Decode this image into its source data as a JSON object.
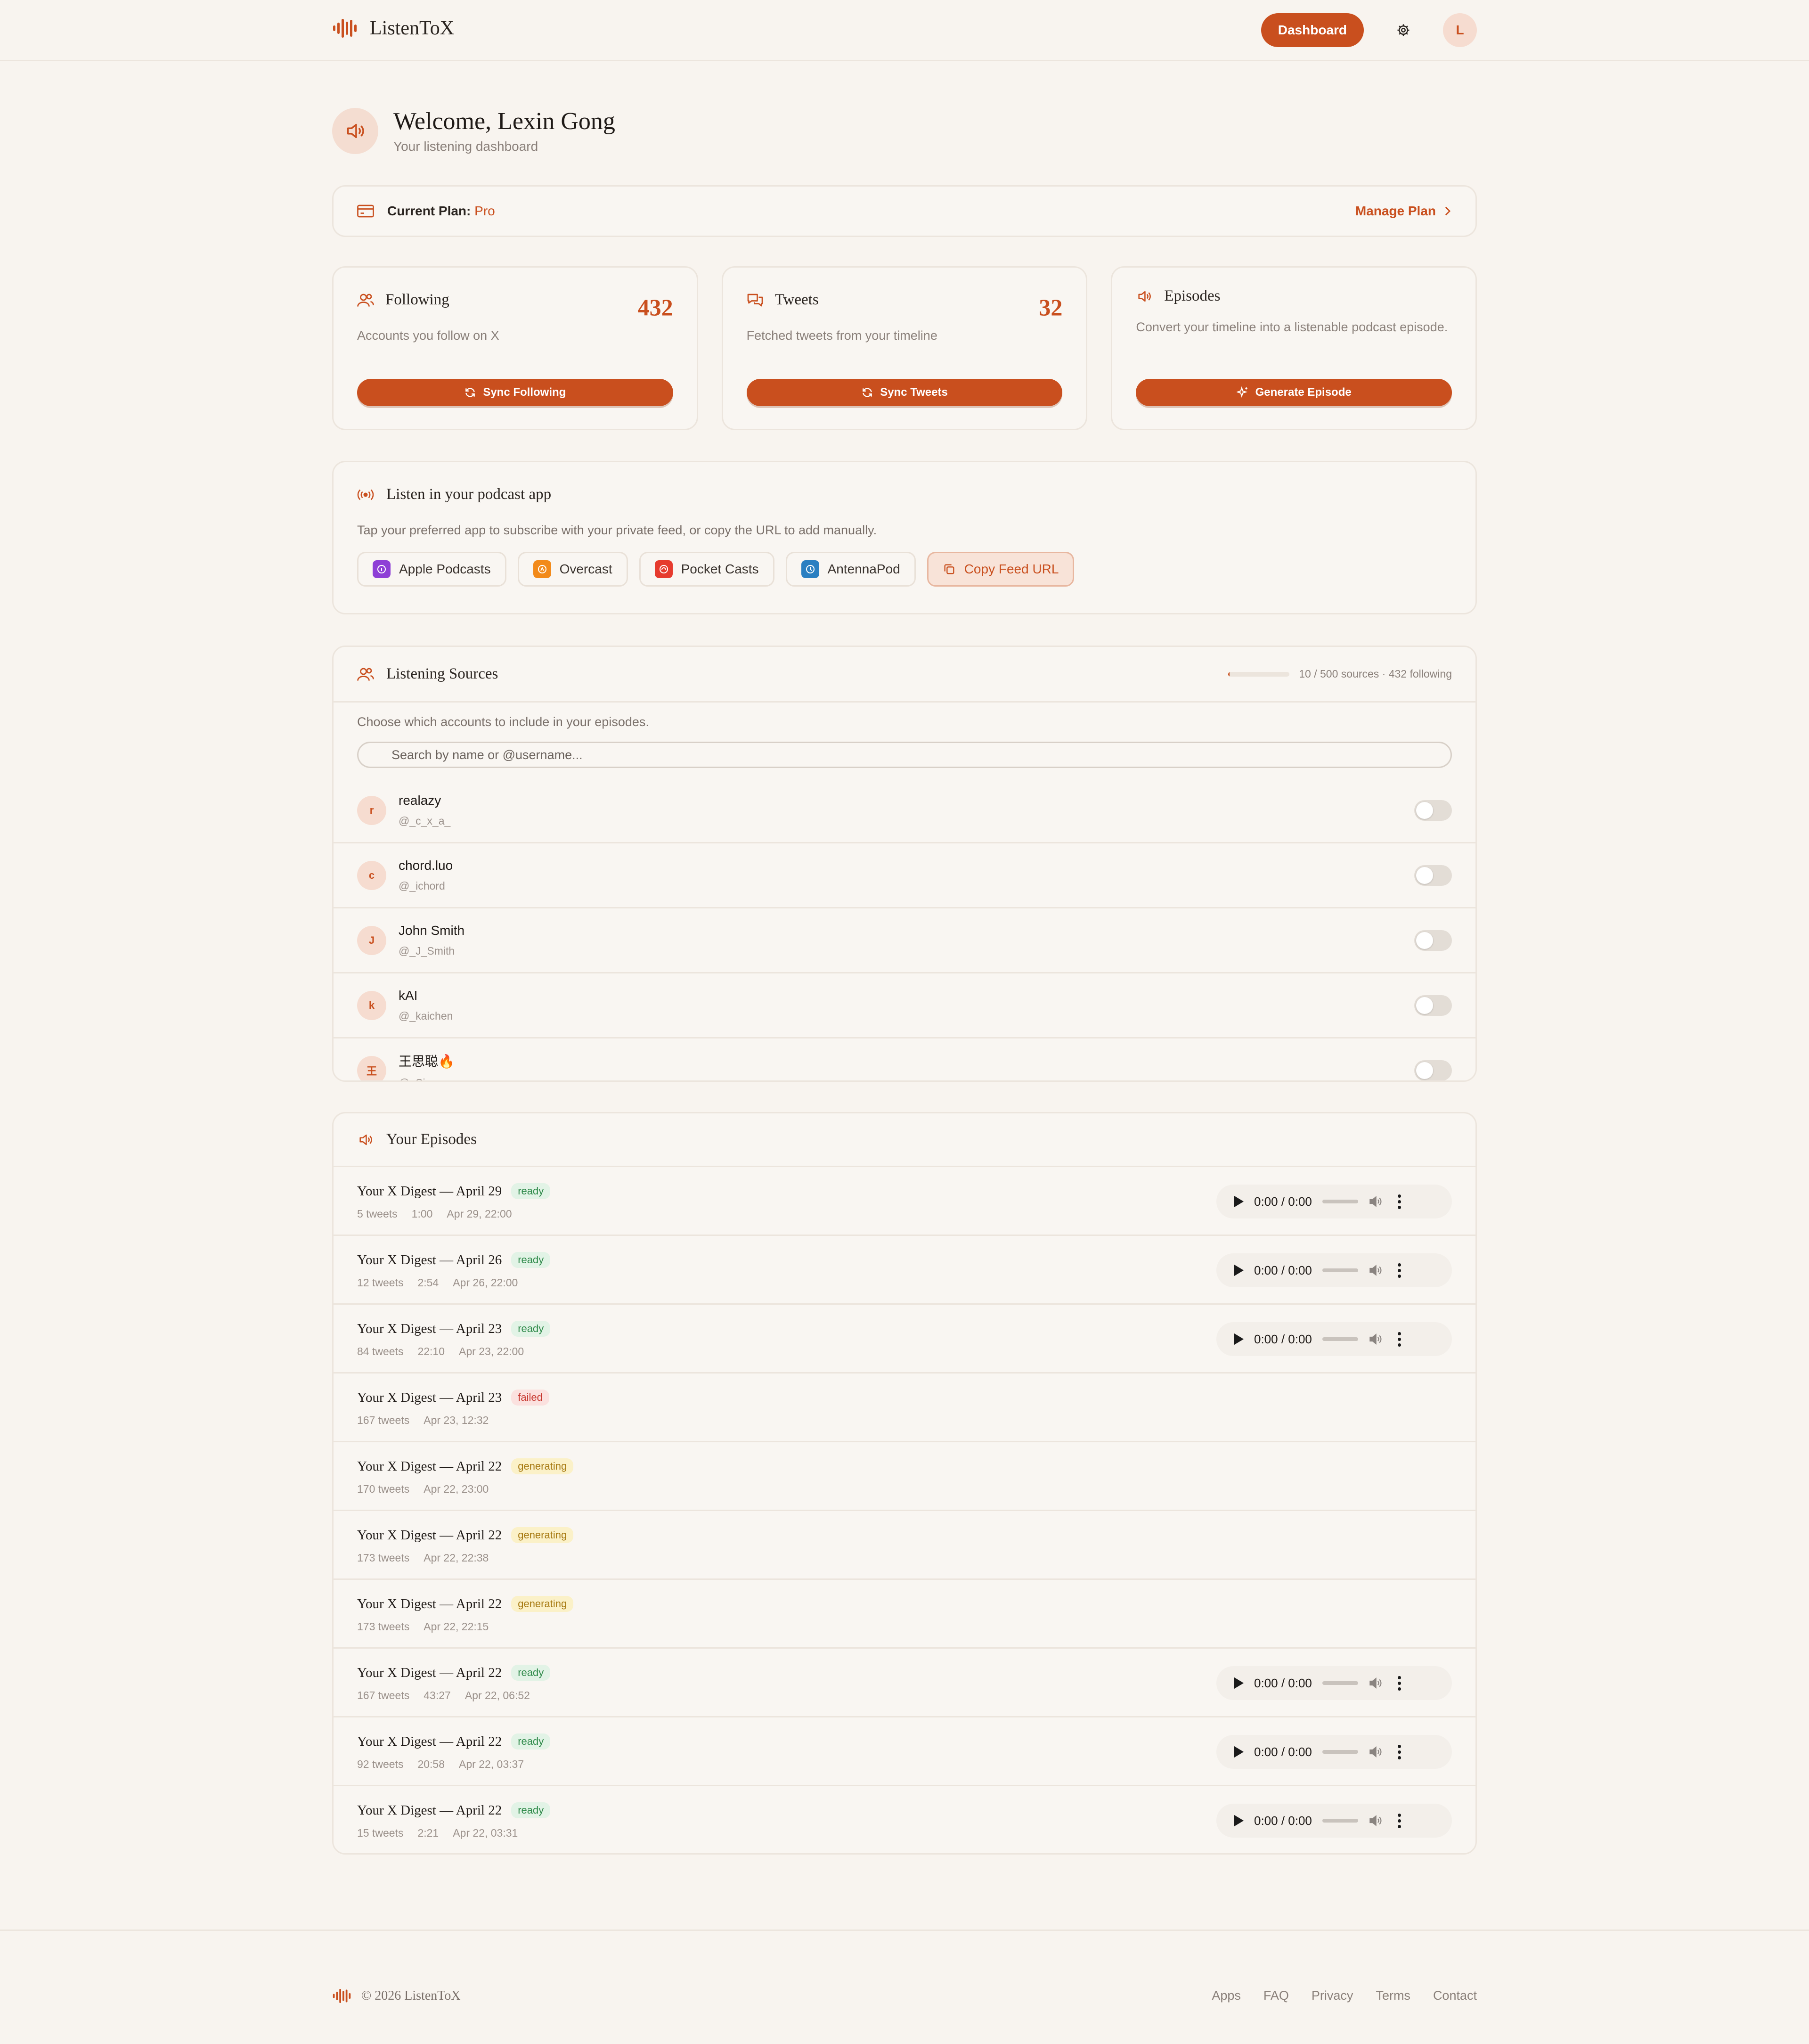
{
  "app": {
    "name": "ListenToX"
  },
  "header": {
    "dashboard_label": "Dashboard",
    "avatar_initial": "L"
  },
  "welcome": {
    "title": "Welcome, Lexin Gong",
    "subtitle": "Your listening dashboard"
  },
  "plan": {
    "label": "Current Plan:",
    "value": "Pro",
    "manage_label": "Manage Plan"
  },
  "stats": {
    "following": {
      "title": "Following",
      "count": "432",
      "desc": "Accounts you follow on X",
      "button": "Sync Following"
    },
    "tweets": {
      "title": "Tweets",
      "count": "32",
      "desc": "Fetched tweets from your timeline",
      "button": "Sync Tweets"
    },
    "episodes": {
      "title": "Episodes",
      "desc": "Convert your timeline into a listenable podcast episode.",
      "button": "Generate Episode"
    }
  },
  "podcast_apps": {
    "title": "Listen in your podcast app",
    "desc": "Tap your preferred app to subscribe with your private feed, or copy the URL to add manually.",
    "apps": [
      {
        "label": "Apple Podcasts",
        "color": "#8e3fd6",
        "icon": "apple-podcasts-icon"
      },
      {
        "label": "Overcast",
        "color": "#f28a1a",
        "icon": "overcast-icon"
      },
      {
        "label": "Pocket Casts",
        "color": "#e63b2e",
        "icon": "pocket-casts-icon"
      },
      {
        "label": "AntennaPod",
        "color": "#2a7fc1",
        "icon": "antennapod-icon"
      }
    ],
    "copy_label": "Copy Feed URL"
  },
  "sources": {
    "title": "Listening Sources",
    "meta": "10 / 500 sources · 432 following",
    "progress_fraction": 0.02,
    "desc": "Choose which accounts to include in your episodes.",
    "search_placeholder": "Search by name or @username...",
    "items": [
      {
        "initial": "r",
        "name": "realazy",
        "user": "@_c_x_a_"
      },
      {
        "initial": "c",
        "name": "chord.luo",
        "user": "@_ichord"
      },
      {
        "initial": "J",
        "name": "John Smith",
        "user": "@_J_Smith"
      },
      {
        "initial": "k",
        "name": "kAI",
        "user": "@_kaichen"
      },
      {
        "initial": "王",
        "name": "王思聪🔥",
        "user": "@_Sicong_wang"
      }
    ]
  },
  "episodes": {
    "title": "Your Episodes",
    "player_time": "0:00 / 0:00",
    "items": [
      {
        "title": "Your X Digest — April 29",
        "status": "ready",
        "tweets": "5 tweets",
        "duration": "1:00",
        "date": "Apr 29, 22:00"
      },
      {
        "title": "Your X Digest — April 26",
        "status": "ready",
        "tweets": "12 tweets",
        "duration": "2:54",
        "date": "Apr 26, 22:00"
      },
      {
        "title": "Your X Digest — April 23",
        "status": "ready",
        "tweets": "84 tweets",
        "duration": "22:10",
        "date": "Apr 23, 22:00"
      },
      {
        "title": "Your X Digest — April 23",
        "status": "failed",
        "tweets": "167 tweets",
        "duration": "",
        "date": "Apr 23, 12:32"
      },
      {
        "title": "Your X Digest — April 22",
        "status": "generating",
        "tweets": "170 tweets",
        "duration": "",
        "date": "Apr 22, 23:00"
      },
      {
        "title": "Your X Digest — April 22",
        "status": "generating",
        "tweets": "173 tweets",
        "duration": "",
        "date": "Apr 22, 22:38"
      },
      {
        "title": "Your X Digest — April 22",
        "status": "generating",
        "tweets": "173 tweets",
        "duration": "",
        "date": "Apr 22, 22:15"
      },
      {
        "title": "Your X Digest — April 22",
        "status": "ready",
        "tweets": "167 tweets",
        "duration": "43:27",
        "date": "Apr 22, 06:52"
      },
      {
        "title": "Your X Digest — April 22",
        "status": "ready",
        "tweets": "92 tweets",
        "duration": "20:58",
        "date": "Apr 22, 03:37"
      },
      {
        "title": "Your X Digest — April 22",
        "status": "ready",
        "tweets": "15 tweets",
        "duration": "2:21",
        "date": "Apr 22, 03:31"
      }
    ]
  },
  "footer": {
    "copyright": "© 2026 ListenToX",
    "links": [
      "Apps",
      "FAQ",
      "Privacy",
      "Terms",
      "Contact"
    ]
  },
  "colors": {
    "accent": "#c94f1e",
    "background": "#f8f4ef"
  }
}
